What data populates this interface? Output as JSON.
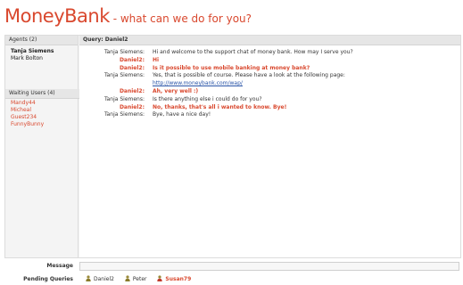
{
  "header": {
    "brand": "MoneyBank",
    "tagline": " - what can we do for you?"
  },
  "colors": {
    "accent": "#d9482e",
    "link": "#2a55a8"
  },
  "sidebar": {
    "agents_heading": "Agents (2)",
    "agents": [
      {
        "name": "Tanja Siemens",
        "active": true
      },
      {
        "name": "Mark Bolton",
        "active": false
      }
    ],
    "waiting_heading": "Waiting Users (4)",
    "waiting_users": [
      "Mandy44",
      "Micheal",
      "Guest234",
      "FunnyBunny"
    ]
  },
  "chat": {
    "query_title": "Query: Daniel2",
    "messages": [
      {
        "sender": "Tanja Siemens:",
        "text": "Hi and welcome to the support chat of money bank. How may I serve you?",
        "customer": false
      },
      {
        "sender": "Daniel2:",
        "text": "Hi",
        "customer": true
      },
      {
        "sender": "Daniel2:",
        "text": "Is it possible to use mobile banking at money bank?",
        "customer": true
      },
      {
        "sender": "Tanja Siemens:",
        "text": "Yes, that is possible of course. Please have a look at the following page:",
        "customer": false
      },
      {
        "sender": "",
        "text": "http://www.moneybank.com/wap/",
        "customer": false,
        "link": true
      },
      {
        "sender": "Daniel2:",
        "text": "Ah, very well :)",
        "customer": true
      },
      {
        "sender": "Tanja Siemens:",
        "text": "Is there anything else i could do for you?",
        "customer": false
      },
      {
        "sender": "Daniel2:",
        "text": "No, thanks, that's all i wanted to know. Bye!",
        "customer": true
      },
      {
        "sender": "Tanja Siemens:",
        "text": "Bye, have a nice day!",
        "customer": false
      }
    ]
  },
  "composer": {
    "label": "Message",
    "value": ""
  },
  "pending": {
    "label": "Pending Queries",
    "items": [
      {
        "name": "Daniel2",
        "icon": "user-icon",
        "alert": false
      },
      {
        "name": "Peter",
        "icon": "user-icon",
        "alert": false
      },
      {
        "name": "Susan79",
        "icon": "user-alert-icon",
        "alert": true
      }
    ]
  }
}
